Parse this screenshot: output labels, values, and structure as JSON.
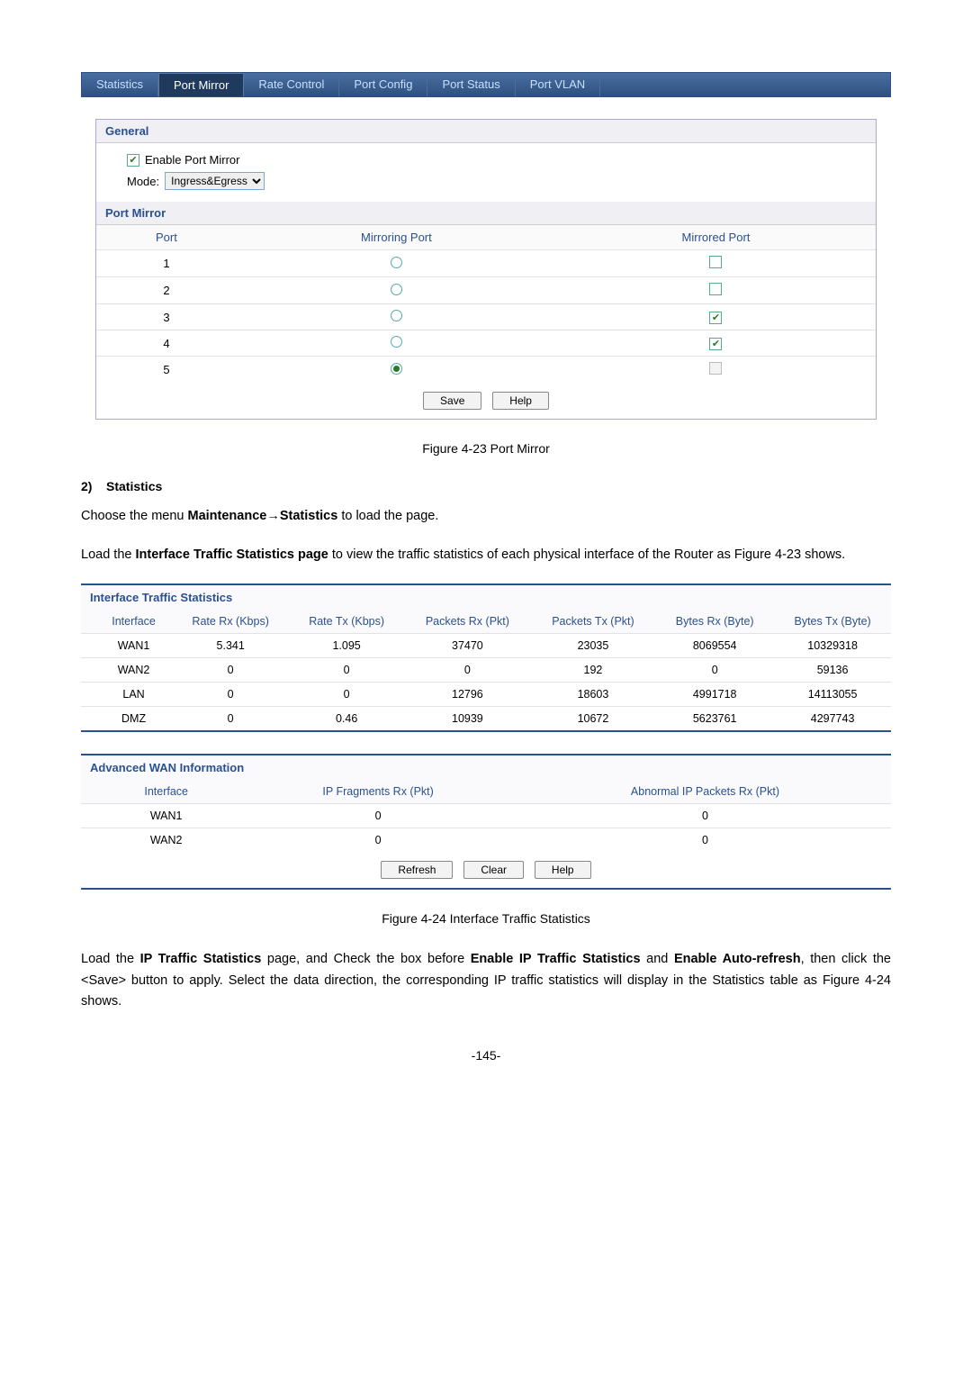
{
  "tabs": [
    "Statistics",
    "Port Mirror",
    "Rate Control",
    "Port Config",
    "Port Status",
    "Port VLAN"
  ],
  "active_tab": 1,
  "general": {
    "title": "General",
    "enable_label": "Enable Port Mirror",
    "enable_checked": true,
    "mode_label": "Mode:",
    "mode_value": "Ingress&Egress"
  },
  "port_mirror": {
    "title": "Port Mirror",
    "headers": [
      "Port",
      "Mirroring Port",
      "Mirrored Port"
    ],
    "rows": [
      {
        "port": "1",
        "mirroring": false,
        "mirrored": false,
        "mirrored_disabled": false
      },
      {
        "port": "2",
        "mirroring": false,
        "mirrored": false,
        "mirrored_disabled": false
      },
      {
        "port": "3",
        "mirroring": false,
        "mirrored": true,
        "mirrored_disabled": false
      },
      {
        "port": "4",
        "mirroring": false,
        "mirrored": true,
        "mirrored_disabled": false
      },
      {
        "port": "5",
        "mirroring": true,
        "mirrored": false,
        "mirrored_disabled": true
      }
    ],
    "buttons": {
      "save": "Save",
      "help": "Help"
    }
  },
  "caption1": "Figure 4-23 Port Mirror",
  "section": {
    "num": "2)",
    "title": "Statistics"
  },
  "para1_a": "Choose the menu ",
  "para1_b": "Maintenance→Statistics",
  "para1_c": " to load the page.",
  "para2_a": "Load the ",
  "para2_b": "Interface Traffic Statistics page",
  "para2_c": " to view the traffic statistics of each physical interface of the Router as Figure 4-23 shows.",
  "its": {
    "title": "Interface Traffic Statistics",
    "headers": [
      "Interface",
      "Rate Rx (Kbps)",
      "Rate Tx (Kbps)",
      "Packets Rx (Pkt)",
      "Packets Tx (Pkt)",
      "Bytes Rx (Byte)",
      "Bytes Tx (Byte)"
    ],
    "rows": [
      [
        "WAN1",
        "5.341",
        "1.095",
        "37470",
        "23035",
        "8069554",
        "10329318"
      ],
      [
        "WAN2",
        "0",
        "0",
        "0",
        "192",
        "0",
        "59136"
      ],
      [
        "LAN",
        "0",
        "0",
        "12796",
        "18603",
        "4991718",
        "14113055"
      ],
      [
        "DMZ",
        "0",
        "0.46",
        "10939",
        "10672",
        "5623761",
        "4297743"
      ]
    ]
  },
  "awi": {
    "title": "Advanced WAN Information",
    "headers": [
      "Interface",
      "IP Fragments Rx (Pkt)",
      "Abnormal IP Packets Rx (Pkt)"
    ],
    "rows": [
      [
        "WAN1",
        "0",
        "0"
      ],
      [
        "WAN2",
        "0",
        "0"
      ]
    ],
    "buttons": {
      "refresh": "Refresh",
      "clear": "Clear",
      "help": "Help"
    }
  },
  "caption2": "Figure 4-24 Interface Traffic Statistics",
  "para3_a": "Load the ",
  "para3_b": "IP Traffic Statistics",
  "para3_c": " page, and Check the box before ",
  "para3_d": "Enable IP Traffic Statistics",
  "para3_e": " and ",
  "para3_f": "Enable Auto-refresh",
  "para3_g": ", then click the <Save> button to apply. Select the data direction, the corresponding IP traffic statistics will display in the Statistics table as Figure 4-24 shows.",
  "pagenum": "-145-"
}
